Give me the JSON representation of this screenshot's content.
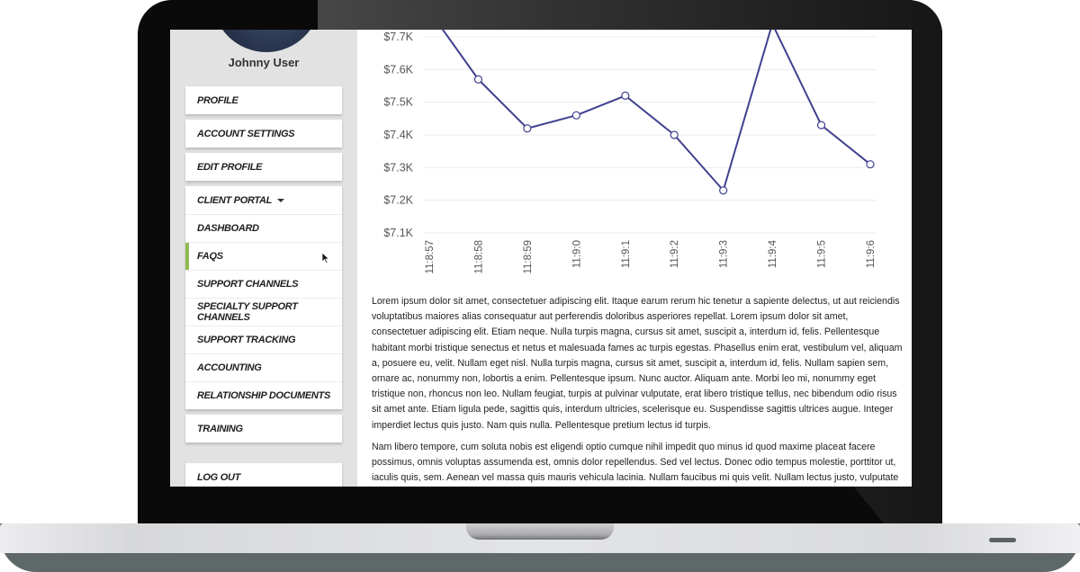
{
  "user": {
    "name": "Johnny User",
    "avatar": "user-photo"
  },
  "sidebar": {
    "groups": [
      {
        "items": [
          {
            "label": "PROFILE"
          }
        ]
      },
      {
        "items": [
          {
            "label": "ACCOUNT SETTINGS"
          }
        ]
      },
      {
        "items": [
          {
            "label": "EDIT PROFILE"
          }
        ]
      },
      {
        "items": [
          {
            "label": "CLIENT PORTAL",
            "icon": "caret-down-icon",
            "expanded": true
          },
          {
            "label": "DASHBOARD"
          },
          {
            "label": "FAQS",
            "active": true
          },
          {
            "label": "SUPPORT CHANNELS"
          },
          {
            "label": "SPECIALTY SUPPORT CHANNELS"
          },
          {
            "label": "SUPPORT TRACKING"
          },
          {
            "label": "ACCOUNTING"
          },
          {
            "label": "RELATIONSHIP DOCUMENTS"
          }
        ]
      },
      {
        "items": [
          {
            "label": "TRAINING"
          }
        ]
      },
      {
        "items": [
          {
            "label": "LOG OUT"
          }
        ]
      }
    ],
    "active_accent": "#8dbb4e"
  },
  "chart_data": {
    "type": "line",
    "title": "",
    "xlabel": "",
    "ylabel": "",
    "x": [
      "11:8:57",
      "11:8:58",
      "11:8:59",
      "11:9:0",
      "11:9:1",
      "11:9:2",
      "11:9:3",
      "11:9:4",
      "11:9:5",
      "11:9:6"
    ],
    "series": [
      {
        "name": "value",
        "values": [
          7780,
          7570,
          7420,
          7460,
          7520,
          7400,
          7230,
          7740,
          7430,
          7310
        ],
        "color": "#3f418f"
      }
    ],
    "yticks": [
      7100,
      7200,
      7300,
      7400,
      7500,
      7600,
      7700
    ],
    "ytick_labels": [
      "$7.1K",
      "$7.2K",
      "$7.3K",
      "$7.4K",
      "$7.5K",
      "$7.6K",
      "$7.7K"
    ],
    "ylim": [
      7100,
      7700
    ],
    "grid": true,
    "legend": "none",
    "markers": "hollow-circle"
  },
  "content": {
    "paragraphs": [
      "Lorem ipsum dolor sit amet, consectetuer adipiscing elit. Itaque earum rerum hic tenetur a sapiente delectus, ut aut reiciendis voluptatibus maiores alias consequatur aut perferendis doloribus asperiores repellat. Lorem ipsum dolor sit amet, consectetuer adipiscing elit. Etiam neque. Nulla turpis magna, cursus sit amet, suscipit a, interdum id, felis. Pellentesque habitant morbi tristique senectus et netus et malesuada fames ac turpis egestas. Phasellus enim erat, vestibulum vel, aliquam a, posuere eu, velit. Nullam eget nisl. Nulla turpis magna, cursus sit amet, suscipit a, interdum id, felis. Nullam sapien sem, ornare ac, nonummy non, lobortis a enim. Pellentesque ipsum. Nunc auctor. Aliquam ante. Morbi leo mi, nonummy eget tristique non, rhoncus non leo. Nullam feugiat, turpis at pulvinar vulputate, erat libero tristique tellus, nec bibendum odio risus sit amet ante. Etiam ligula pede, sagittis quis, interdum ultricies, scelerisque eu. Suspendisse sagittis ultrices augue. Integer imperdiet lectus quis justo. Nam quis nulla. Pellentesque pretium lectus id turpis.",
      "Nam libero tempore, cum soluta nobis est eligendi optio cumque nihil impedit quo minus id quod maxime placeat facere possimus, omnis voluptas assumenda est, omnis dolor repellendus. Sed vel lectus. Donec odio tempus molestie, porttitor ut, iaculis quis, sem. Aenean vel massa quis mauris vehicula lacinia. Nullam faucibus mi quis velit. Nullam lectus justo, vulputate eget"
    ]
  }
}
